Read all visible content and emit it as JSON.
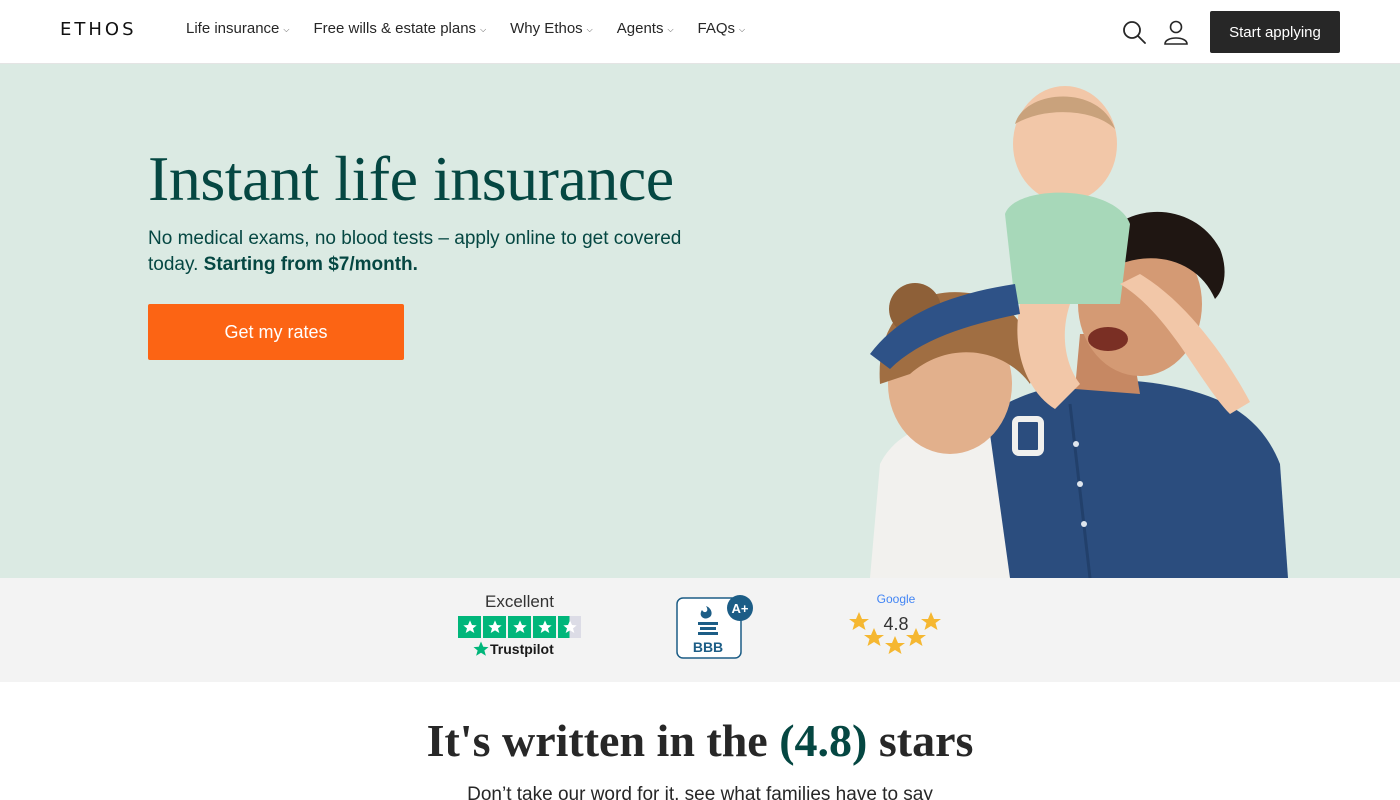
{
  "header": {
    "logo": "ETHOS",
    "nav": [
      {
        "label": "Life insurance"
      },
      {
        "label": "Free wills & estate plans"
      },
      {
        "label": "Why Ethos"
      },
      {
        "label": "Agents"
      },
      {
        "label": "FAQs"
      }
    ],
    "search_icon": "search-icon",
    "account_icon": "user-icon",
    "cta_label": "Start applying"
  },
  "hero": {
    "title": "Instant life insurance",
    "subtitle_plain": "No medical exams, no blood tests – apply online to get covered today.",
    "subtitle_bold": "Starting from $7/month.",
    "cta_label": "Get my rates",
    "background_color": "#dbeae3",
    "title_color": "#054742",
    "cta_color": "#fc6414"
  },
  "ratings": {
    "trustpilot": {
      "rating_word": "Excellent",
      "brand": "Trustpilot"
    },
    "bbb": {
      "grade": "A+",
      "brand": "BBB"
    },
    "google": {
      "brand": "Google",
      "score": "4.8"
    }
  },
  "testimonials": {
    "title_before": "It's written in the",
    "title_accent": "(4.8)",
    "title_after": "stars",
    "subtitle": "Don’t take our word for it, see what families have to say"
  }
}
